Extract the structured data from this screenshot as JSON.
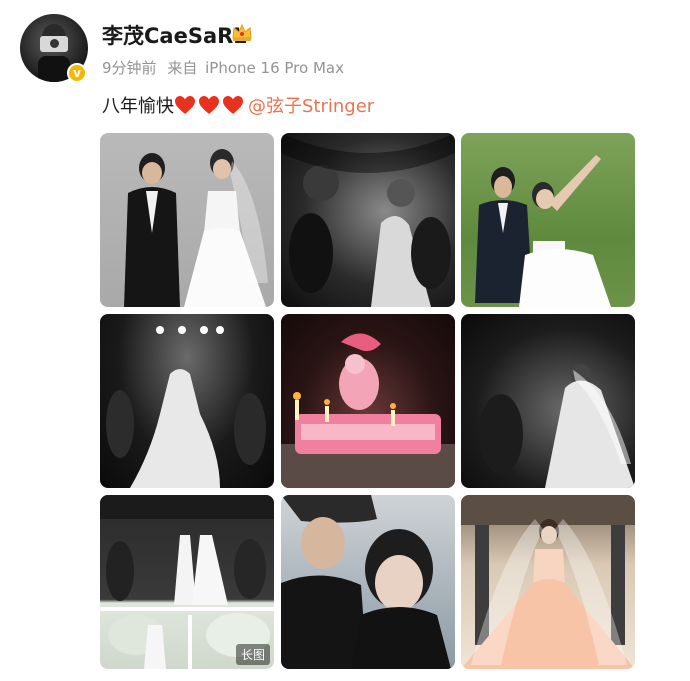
{
  "post": {
    "username": "李茂CaeSaRL",
    "time": "9分钟前",
    "source_prefix": "来自",
    "device": "iPhone 16 Pro Max",
    "text": "八年愉快",
    "mention": "@弦子Stringer"
  },
  "gallery": {
    "long_image_badge": "长图"
  },
  "colors": {
    "mention": "#eb7350",
    "heart": "#e8321e",
    "verified_badge": "#f5b800",
    "meta": "#939393"
  },
  "icons": {
    "verified": "verified-badge-icon",
    "crown": "crown-icon",
    "heart": "red-heart-icon"
  }
}
